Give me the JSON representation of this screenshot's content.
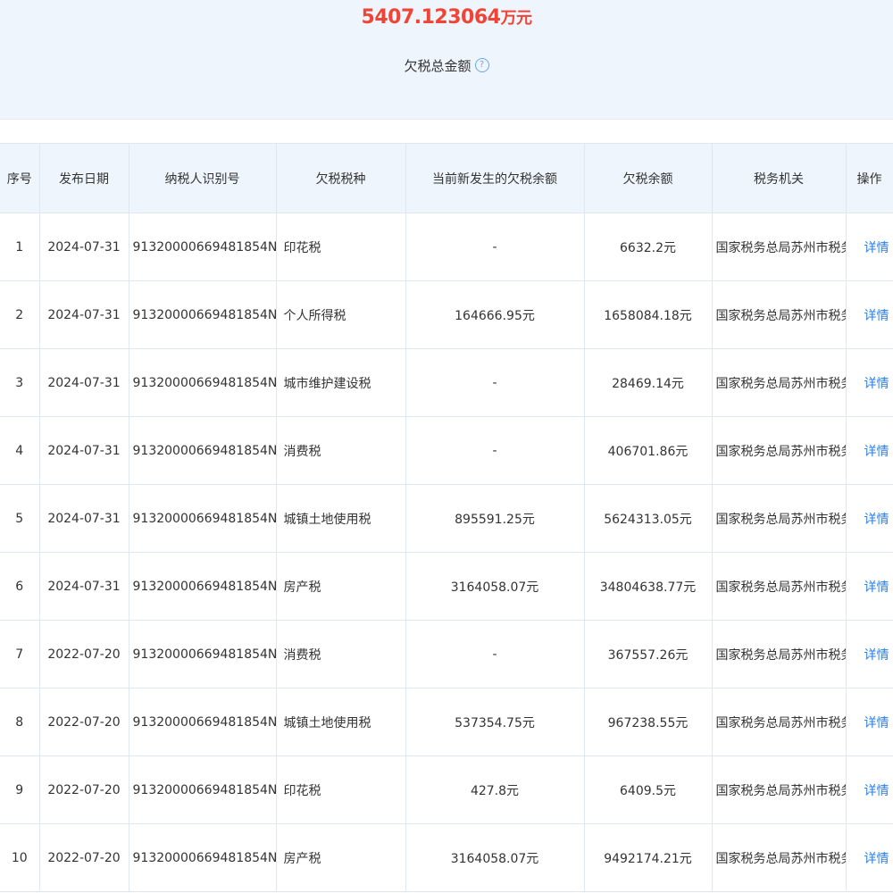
{
  "summary": {
    "amount": "5407.123064",
    "unit": "万元",
    "label": "欠税总金额",
    "help_glyph": "?"
  },
  "table": {
    "headers": {
      "index": "序号",
      "date": "发布日期",
      "taxpayer_id": "纳税人识别号",
      "tax_type": "欠税税种",
      "new_balance": "当前新发生的欠税余额",
      "balance": "欠税余额",
      "authority": "税务机关",
      "action": "操作"
    },
    "rows": [
      {
        "index": "1",
        "date": "2024-07-31",
        "taxpayer_id": "91320000669481854N",
        "tax_type": "印花税",
        "new_balance": "-",
        "balance": "6632.2元",
        "authority": "国家税务总局苏州市税务局",
        "action": "详情"
      },
      {
        "index": "2",
        "date": "2024-07-31",
        "taxpayer_id": "91320000669481854N",
        "tax_type": "个人所得税",
        "new_balance": "164666.95元",
        "balance": "1658084.18元",
        "authority": "国家税务总局苏州市税务局",
        "action": "详情"
      },
      {
        "index": "3",
        "date": "2024-07-31",
        "taxpayer_id": "91320000669481854N",
        "tax_type": "城市维护建设税",
        "new_balance": "-",
        "balance": "28469.14元",
        "authority": "国家税务总局苏州市税务局",
        "action": "详情"
      },
      {
        "index": "4",
        "date": "2024-07-31",
        "taxpayer_id": "91320000669481854N",
        "tax_type": "消费税",
        "new_balance": "-",
        "balance": "406701.86元",
        "authority": "国家税务总局苏州市税务局",
        "action": "详情"
      },
      {
        "index": "5",
        "date": "2024-07-31",
        "taxpayer_id": "91320000669481854N",
        "tax_type": "城镇土地使用税",
        "new_balance": "895591.25元",
        "balance": "5624313.05元",
        "authority": "国家税务总局苏州市税务局",
        "action": "详情"
      },
      {
        "index": "6",
        "date": "2024-07-31",
        "taxpayer_id": "91320000669481854N",
        "tax_type": "房产税",
        "new_balance": "3164058.07元",
        "balance": "34804638.77元",
        "authority": "国家税务总局苏州市税务局",
        "action": "详情"
      },
      {
        "index": "7",
        "date": "2022-07-20",
        "taxpayer_id": "91320000669481854N",
        "tax_type": "消费税",
        "new_balance": "-",
        "balance": "367557.26元",
        "authority": "国家税务总局苏州市税务局",
        "action": "详情"
      },
      {
        "index": "8",
        "date": "2022-07-20",
        "taxpayer_id": "91320000669481854N",
        "tax_type": "城镇土地使用税",
        "new_balance": "537354.75元",
        "balance": "967238.55元",
        "authority": "国家税务总局苏州市税务局",
        "action": "详情"
      },
      {
        "index": "9",
        "date": "2022-07-20",
        "taxpayer_id": "91320000669481854N",
        "tax_type": "印花税",
        "new_balance": "427.8元",
        "balance": "6409.5元",
        "authority": "国家税务总局苏州市税务局",
        "action": "详情"
      },
      {
        "index": "10",
        "date": "2022-07-20",
        "taxpayer_id": "91320000669481854N",
        "tax_type": "房产税",
        "new_balance": "3164058.07元",
        "balance": "9492174.21元",
        "authority": "国家税务总局苏州市税务局",
        "action": "详情"
      }
    ]
  },
  "colors": {
    "amount": "#f04437",
    "link": "#2b7de0",
    "header_bg": "#eff5fc"
  }
}
